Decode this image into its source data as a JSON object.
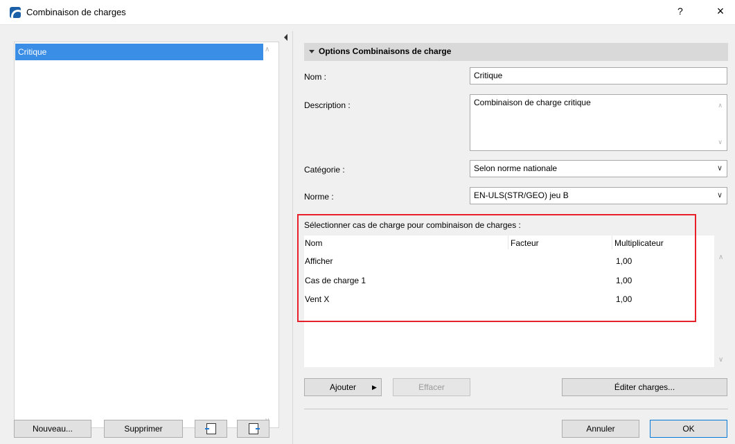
{
  "window": {
    "title": "Combinaison de charges",
    "help": "?",
    "close": "×"
  },
  "left": {
    "items": [
      {
        "label": "Critique",
        "selected": true
      }
    ],
    "buttons": {
      "new": "Nouveau...",
      "delete": "Supprimer"
    }
  },
  "panel": {
    "section_title": "Options Combinaisons de charge",
    "name_label": "Nom :",
    "name_value": "Critique",
    "description_label": "Description :",
    "description_value": "Combinaison de charge critique",
    "category_label": "Catégorie :",
    "category_value": "Selon norme nationale",
    "norm_label": "Norme :",
    "norm_value": "EN-ULS(STR/GEO) jeu B",
    "select_cases_label": "Sélectionner cas de charge pour combinaison de charges :"
  },
  "table": {
    "headers": [
      "Nom",
      "Facteur",
      "Multiplicateur"
    ],
    "rows": [
      {
        "name": "Afficher",
        "factor": "",
        "multiplier": "1,00"
      },
      {
        "name": "Cas de charge 1",
        "factor": "",
        "multiplier": "1,00"
      },
      {
        "name": "Vent X",
        "factor": "",
        "multiplier": "1,00"
      }
    ]
  },
  "buttons": {
    "add": "Ajouter",
    "erase": "Effacer",
    "edit_loads": "Éditer charges...",
    "cancel": "Annuler",
    "ok": "OK"
  },
  "colors": {
    "selection": "#3a8ee6",
    "highlight_box": "#e8202a",
    "ok_border": "#0078d7"
  },
  "icons": [
    "app-icon",
    "import-icon",
    "export-icon",
    "chevron-down-icon",
    "scroll-up-icon",
    "scroll-down-icon",
    "collapse-arrow-icon",
    "submenu-arrow-icon"
  ]
}
